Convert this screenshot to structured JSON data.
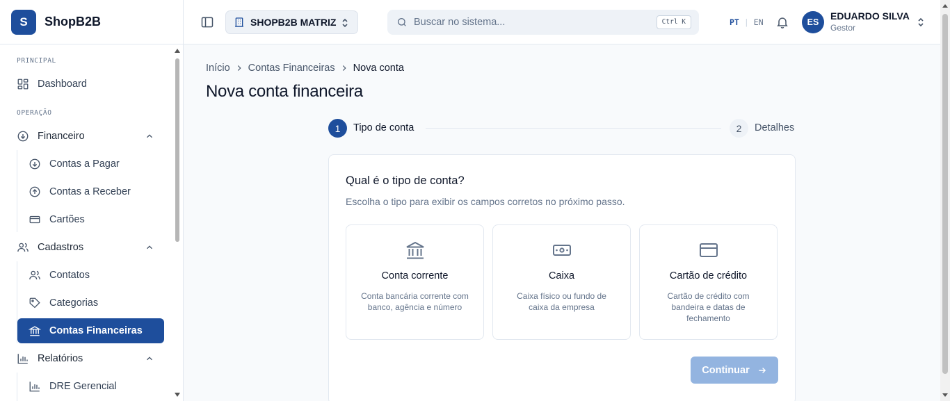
{
  "brand": {
    "logo_letter": "S",
    "name": "ShopB2B"
  },
  "sidebar": {
    "sections": [
      {
        "label": "PRINCIPAL"
      },
      {
        "label": "OPERAÇÃO"
      }
    ],
    "items": {
      "dashboard": {
        "label": "Dashboard",
        "icon": "dashboard-icon"
      },
      "financeiro": {
        "label": "Financeiro",
        "icon": "arrow-down-circle-icon",
        "expanded": true
      },
      "contas_pagar": {
        "label": "Contas a Pagar",
        "icon": "arrow-down-circle-icon"
      },
      "contas_receber": {
        "label": "Contas a Receber",
        "icon": "arrow-up-circle-icon"
      },
      "cartoes": {
        "label": "Cartões",
        "icon": "credit-card-icon"
      },
      "cadastros": {
        "label": "Cadastros",
        "icon": "users-icon",
        "expanded": true
      },
      "contatos": {
        "label": "Contatos",
        "icon": "users-icon"
      },
      "categorias": {
        "label": "Categorias",
        "icon": "tag-icon"
      },
      "contas_financeiras": {
        "label": "Contas Financeiras",
        "icon": "bank-icon",
        "active": true
      },
      "relatorios": {
        "label": "Relatórios",
        "icon": "bar-chart-icon",
        "expanded": true
      },
      "dre": {
        "label": "DRE Gerencial",
        "icon": "bar-chart-icon"
      }
    }
  },
  "header": {
    "company": "SHOPB2B MATRIZ",
    "search": {
      "placeholder": "Buscar no sistema...",
      "shortcut": "Ctrl K"
    },
    "languages": {
      "active": "PT",
      "other": "EN"
    },
    "user": {
      "initials": "ES",
      "name": "EDUARDO SILVA",
      "role": "Gestor"
    }
  },
  "main": {
    "breadcrumb": [
      "Início",
      "Contas Financeiras",
      "Nova conta"
    ],
    "title": "Nova conta financeira",
    "steps": [
      {
        "number": "1",
        "label": "Tipo de conta",
        "active": true
      },
      {
        "number": "2",
        "label": "Detalhes",
        "active": false
      }
    ],
    "card": {
      "title": "Qual é o tipo de conta?",
      "subtitle": "Escolha o tipo para exibir os campos corretos no próximo passo.",
      "options": [
        {
          "title": "Conta corrente",
          "description": "Conta bancária corrente com banco, agência e número",
          "icon": "bank-icon"
        },
        {
          "title": "Caixa",
          "description": "Caixa físico ou fundo de caixa da empresa",
          "icon": "cash-icon"
        },
        {
          "title": "Cartão de crédito",
          "description": "Cartão de crédito com bandeira e datas de fechamento",
          "icon": "credit-card-icon"
        }
      ],
      "continue_label": "Continuar",
      "continue_disabled": true
    }
  },
  "colors": {
    "primary": "#1e4e9c",
    "primary_disabled": "#93b4e0",
    "muted_text": "#64748b",
    "border": "#e2e8f0"
  }
}
